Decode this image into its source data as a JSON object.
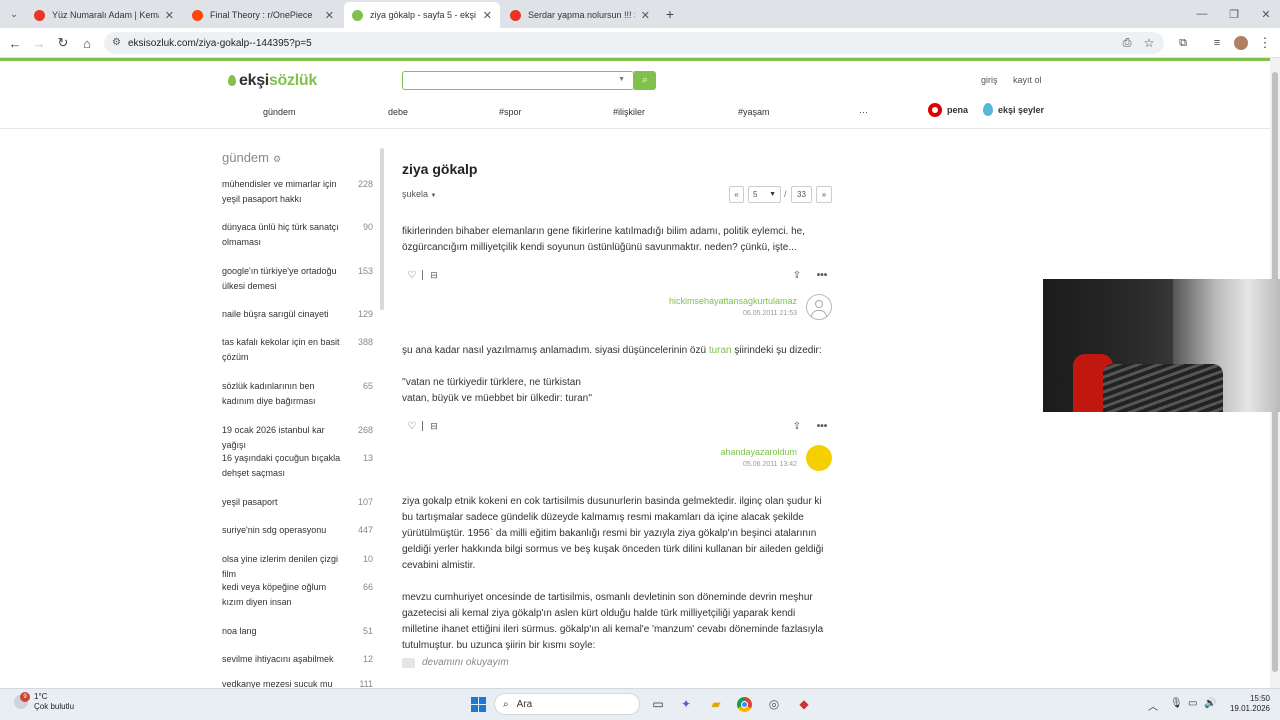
{
  "browser": {
    "tabs": [
      {
        "title": "Yüz Numaralı Adam | Kemal",
        "active": false,
        "fav_color": "#e32"
      },
      {
        "title": "Final Theory : r/OnePiece",
        "active": false,
        "fav_color": "#ff4500"
      },
      {
        "title": "ziya gökalp - sayfa 5 - ekşi sözlük",
        "active": true,
        "fav_color": "#81c14b"
      },
      {
        "title": "Serdar yapma nolursun !!! Sözlük",
        "active": false,
        "fav_color": "#e32"
      }
    ],
    "url": "eksisozluk.com/ziya-gokalp--144395?p=5"
  },
  "site": {
    "logo": {
      "a": "ekşi",
      "b": "sözlük"
    },
    "search_placeholder": "",
    "login": "giriş",
    "register": "kayıt ol",
    "nav": [
      "gündem",
      "debe",
      "#spor",
      "#ilişkiler",
      "#yaşam",
      "···"
    ],
    "pena": "pena",
    "eksi_seyler": "ekşi şeyler"
  },
  "sidebar": {
    "heading": "gündem",
    "items": [
      {
        "title": "mühendisler ve mimarlar için yeşil pasaport hakkı",
        "count": "228"
      },
      {
        "title": "dünyaca ünlü hiç türk sanatçı olmaması",
        "count": "90"
      },
      {
        "title": "google'ın türkiye'ye ortadoğu ülkesi demesi",
        "count": "153"
      },
      {
        "title": "naile büşra sarıgül cinayeti",
        "count": "129"
      },
      {
        "title": "tas kafalı kekolar için en basit çözüm",
        "count": "388"
      },
      {
        "title": "sözlük kadınlarının ben kadınım diye bağırması",
        "count": "65"
      },
      {
        "title": "19 ocak 2026 istanbul kar yağışı",
        "count": "268"
      },
      {
        "title": "16 yaşındaki çocuğun bıçakla dehşet saçması",
        "count": "13"
      },
      {
        "title": "yeşil pasaport",
        "count": "107"
      },
      {
        "title": "suriye'nin sdg operasyonu",
        "count": "447"
      },
      {
        "title": "olsa yine izlerim denilen çizgi film",
        "count": "10"
      },
      {
        "title": "kedi veya köpeğine oğlum kızım diyen insan",
        "count": "66"
      },
      {
        "title": "noa lang",
        "count": "51"
      },
      {
        "title": "sevilme ihtiyacını aşabilmek",
        "count": "12"
      },
      {
        "title": "vedkanye mezesi sucuk mu ton",
        "count": "111"
      }
    ]
  },
  "topic": {
    "title": "ziya gökalp",
    "sort": "şukela",
    "page_prev": "«",
    "page_current": "5",
    "page_sep": "/",
    "page_total": "33",
    "page_next": "»"
  },
  "entries": [
    {
      "text": "fikirlerinden bihaber elemanların gene fikirlerine katılmadığı bilim adamı, politik eylemci. he, özgürcancığım milliyetçilik kendi soyunun üstünlüğünü savunmaktır. neden? çünkü, işte...",
      "author": "hickimsehayattansagkurtulamaz",
      "date": "06.05.2011 21:53"
    },
    {
      "text_a": "şu ana kadar nasıl yazılmamış anlamadım. siyasi düşüncelerinin özü ",
      "link": "turan",
      "text_b": " şiirindeki şu dizedir:",
      "quote1": "''vatan ne türkiyedir türklere, ne türkistan",
      "quote2": "vatan, büyük ve müebbet bir ülkedir: turan''",
      "author": "ahandayazaroldum",
      "date": "05.06.2011 13:42"
    },
    {
      "p1": "ziya gokalp etnik kokeni en cok tartisilmis dusunurlerin basinda gelmektedir. ilginç olan şudur ki bu tartışmalar sadece gündelik düzeyde kalmamış resmi makamları da içine alacak şekilde yürütülmüştür. 1956` da milli eğitim bakanlığı resmi bir yazıyla ziya gökalp'ın beşinci atalarının geldiği yerler hakkında bilgi sormus ve beş kuşak önceden türk dilini kullanan bir aileden geldiği cevabini almistir.",
      "p2": "mevzu cumhuriyet oncesinde de tartisilmis, osmanlı devletinin son döneminde devrin meşhur gazetecisi ali kemal ziya gökalp'ın aslen kürt olduğu halde türk milliyetçiliği yaparak kendi milletine ihanet ettiğini ileri sürmus. gökalp'ın ali kemal'e 'manzum' cevabı döneminde fazlasıyla tutulmuştur. bu uzunca şiirin bir kısmı soyle:",
      "more": "devamını okuyayım"
    }
  ],
  "taskbar": {
    "weather_temp": "1°C",
    "weather_desc": "Çok bulutlu",
    "weather_badge": "9",
    "search": "Ara",
    "time": "15:50",
    "date": "19.01.2026"
  }
}
